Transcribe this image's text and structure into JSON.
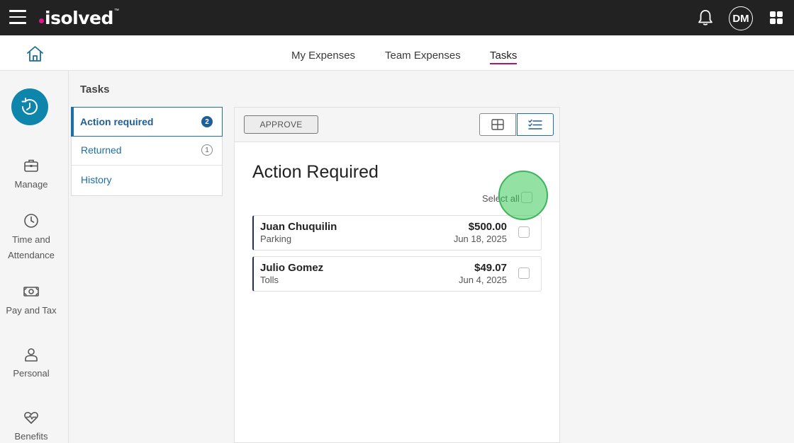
{
  "app": {
    "logo_text": "isolved",
    "logo_mark": "™",
    "user_initials": "DM",
    "brand_color": "#e0168f",
    "accent_color": "#1d6fa8"
  },
  "topbar": {
    "icons": [
      "hamburger-icon",
      "bell-icon",
      "apps-grid-icon"
    ]
  },
  "subnav": {
    "tabs": [
      {
        "label": "My Expenses"
      },
      {
        "label": "Team Expenses"
      },
      {
        "label": "Tasks",
        "active": true
      }
    ]
  },
  "rail": {
    "items": [
      {
        "label": "Manage",
        "icon": "briefcase-icon"
      },
      {
        "label": "Time and Attendance",
        "icon": "clock-icon"
      },
      {
        "label": "Pay and Tax",
        "icon": "money-icon"
      },
      {
        "label": "Personal",
        "icon": "person-icon"
      },
      {
        "label": "Benefits",
        "icon": "heart-pulse-icon"
      }
    ]
  },
  "tasks": {
    "title": "Tasks",
    "items": [
      {
        "label": "Action required",
        "count": "2",
        "active": true
      },
      {
        "label": "Returned",
        "count": "1"
      },
      {
        "label": "History"
      }
    ]
  },
  "main": {
    "approve_label": "APPROVE",
    "section_title": "Action Required",
    "select_all_label": "Select all",
    "expenses": [
      {
        "name": "Juan Chuquilin",
        "category": "Parking",
        "amount": "$500.00",
        "date": "Jun 18, 2025"
      },
      {
        "name": "Julio Gomez",
        "category": "Tolls",
        "amount": "$49.07",
        "date": "Jun 4, 2025"
      }
    ]
  }
}
